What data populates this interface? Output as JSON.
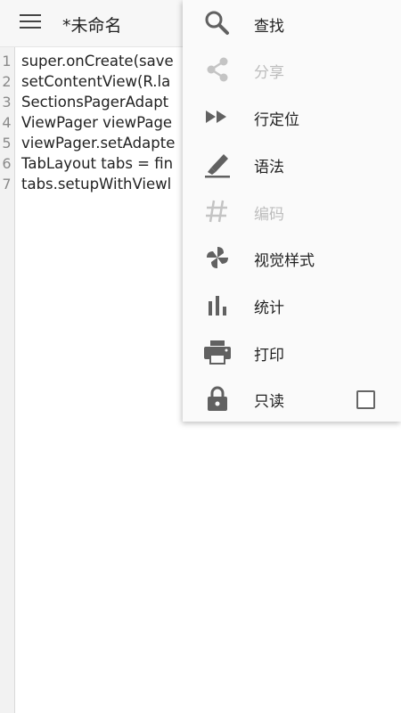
{
  "toolbar": {
    "title": "*未命名",
    "menu_icon": "hamburger-icon"
  },
  "editor": {
    "lines": [
      {
        "no": "1",
        "text": "super.onCreate(save"
      },
      {
        "no": "2",
        "text": "setContentView(R.la"
      },
      {
        "no": "3",
        "text": "SectionsPagerAdapt"
      },
      {
        "no": "4",
        "text": "ViewPager viewPage"
      },
      {
        "no": "5",
        "text": "viewPager.setAdapte"
      },
      {
        "no": "6",
        "text": "TabLayout tabs = fin"
      },
      {
        "no": "7",
        "text": "tabs.setupWithViewl"
      }
    ]
  },
  "menu": {
    "items": [
      {
        "label": "查找",
        "icon": "search-icon",
        "enabled": true
      },
      {
        "label": "分享",
        "icon": "share-icon",
        "enabled": false
      },
      {
        "label": "行定位",
        "icon": "fast-forward-icon",
        "enabled": true
      },
      {
        "label": "语法",
        "icon": "highlighter-icon",
        "enabled": true
      },
      {
        "label": "编码",
        "icon": "hash-icon",
        "enabled": false
      },
      {
        "label": "视觉样式",
        "icon": "pinwheel-icon",
        "enabled": true
      },
      {
        "label": "统计",
        "icon": "bar-chart-icon",
        "enabled": true
      },
      {
        "label": "打印",
        "icon": "printer-icon",
        "enabled": true
      },
      {
        "label": "只读",
        "icon": "lock-icon",
        "enabled": true,
        "checked": false
      }
    ]
  },
  "colors": {
    "icon": "#616161",
    "icon_disabled": "#c4c4c4",
    "text": "#222222",
    "text_disabled": "#bdbdbd",
    "menu_bg": "#fafafa",
    "toolbar_bg": "#f7f7f7"
  }
}
